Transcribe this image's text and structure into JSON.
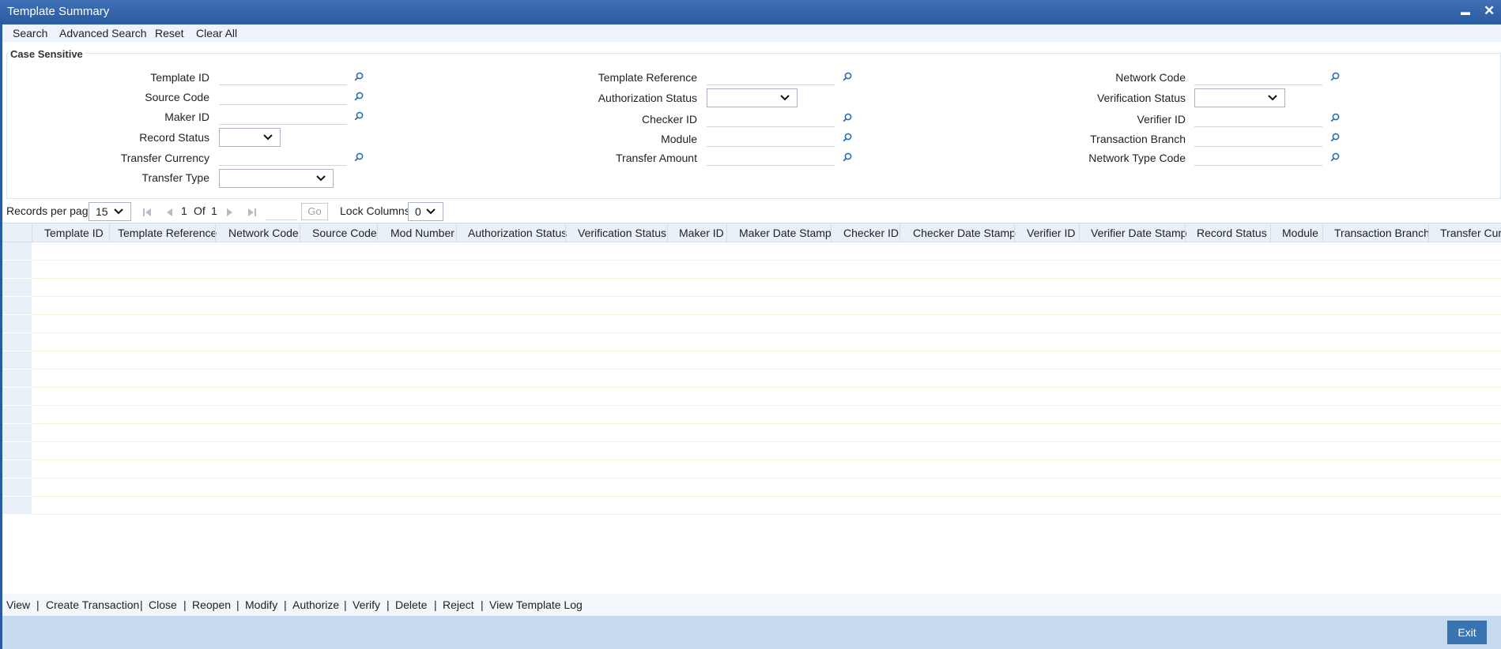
{
  "window": {
    "title": "Template Summary",
    "minimize_glyph": "▬",
    "close_glyph": "✕"
  },
  "toolbar": {
    "search": "Search",
    "advanced_search": "Advanced Search",
    "reset": "Reset",
    "clear_all": "Clear All"
  },
  "criteria": {
    "section_label": "Case Sensitive",
    "template_id": "Template ID",
    "source_code": "Source Code",
    "maker_id": "Maker ID",
    "record_status": "Record Status",
    "transfer_currency": "Transfer Currency",
    "transfer_type": "Transfer Type",
    "template_reference": "Template Reference",
    "authorization_status": "Authorization Status",
    "checker_id": "Checker ID",
    "module": "Module",
    "transfer_amount": "Transfer Amount",
    "network_code": "Network Code",
    "verification_status": "Verification Status",
    "verifier_id": "Verifier ID",
    "transaction_branch": "Transaction Branch",
    "network_type_code": "Network Type Code"
  },
  "pager": {
    "records_per_page_label": "Records per page",
    "records_per_page_value": "15",
    "current_page": "1",
    "of_label": "Of",
    "total_pages": "1",
    "go_label": "Go",
    "lock_columns_label": "Lock Columns",
    "lock_columns_value": "0"
  },
  "grid": {
    "columns": [
      "Template ID",
      "Template Reference",
      "Network Code",
      "Source Code",
      "Mod Number",
      "Authorization Status",
      "Verification Status",
      "Maker ID",
      "Maker Date Stamp",
      "Checker ID",
      "Checker Date Stamp",
      "Verifier ID",
      "Verifier Date Stamp",
      "Record Status",
      "Module",
      "Transaction Branch",
      "Transfer Curr"
    ],
    "empty_row_count": 15
  },
  "actions": {
    "view": "View",
    "create_transaction": "Create Transaction",
    "close": "Close",
    "reopen": "Reopen",
    "modify": "Modify",
    "authorize": "Authorize",
    "verify": "Verify",
    "delete": "Delete",
    "reject": "Reject",
    "view_template_log": "View Template Log",
    "separator": "|"
  },
  "footer": {
    "exit": "Exit"
  },
  "colors": {
    "titlebar": "#2a5aa0",
    "icon": "#2e6db4",
    "exit_button": "#3a74b0",
    "footer": "#c6daf0"
  }
}
